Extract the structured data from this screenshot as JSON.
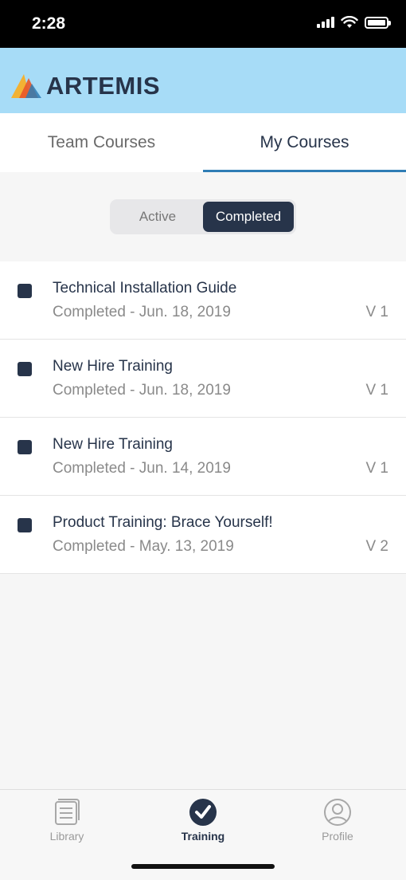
{
  "status_bar": {
    "time": "2:28"
  },
  "header": {
    "logo_text": "ARTEMIS"
  },
  "tabs": [
    {
      "label": "Team Courses",
      "active": false
    },
    {
      "label": "My Courses",
      "active": true
    }
  ],
  "filter": {
    "options": [
      {
        "label": "Active",
        "selected": false
      },
      {
        "label": "Completed",
        "selected": true
      }
    ]
  },
  "courses": [
    {
      "title": "Technical Installation Guide",
      "status": "Completed - Jun. 18, 2019",
      "version": "V 1"
    },
    {
      "title": "New Hire Training",
      "status": "Completed - Jun. 18, 2019",
      "version": "V 1"
    },
    {
      "title": "New Hire Training",
      "status": "Completed - Jun. 14, 2019",
      "version": "V 1"
    },
    {
      "title": "Product Training: Brace Yourself!",
      "status": "Completed - May. 13, 2019",
      "version": "V 2"
    }
  ],
  "bottom_nav": [
    {
      "label": "Library",
      "icon": "library-icon",
      "active": false
    },
    {
      "label": "Training",
      "icon": "checkmark-circle-icon",
      "active": true
    },
    {
      "label": "Profile",
      "icon": "profile-icon",
      "active": false
    }
  ],
  "colors": {
    "header_bg": "#a7dcf7",
    "accent": "#27344a",
    "tab_underline": "#2f7db5"
  }
}
